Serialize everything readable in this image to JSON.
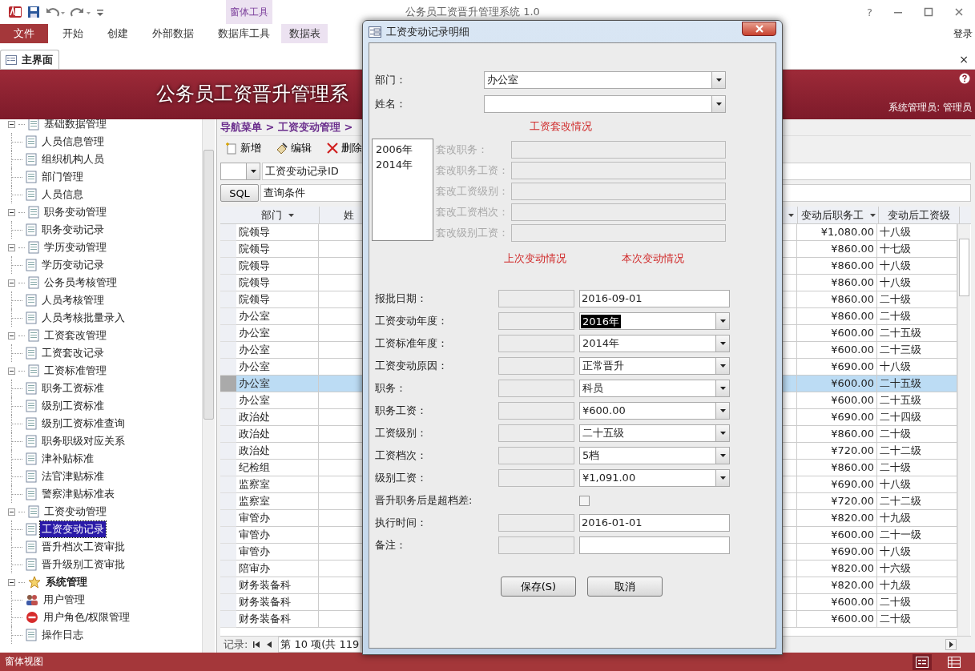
{
  "window": {
    "title": "公务员工资晋升管理系统 1.0",
    "help": "?"
  },
  "ribbon": {
    "context_label": "窗体工具",
    "file_tab": "文件",
    "tabs": [
      {
        "label": "开始",
        "selected": false
      },
      {
        "label": "创建",
        "selected": false
      },
      {
        "label": "外部数据",
        "selected": false
      },
      {
        "label": "数据库工具",
        "selected": false
      },
      {
        "label": "数据表",
        "selected": false
      }
    ],
    "login": "登录"
  },
  "document_tab": {
    "label": "主界面",
    "close": "×"
  },
  "banner": {
    "title": "公务员工资晋升管理系",
    "user": "系统管理员: 管理员"
  },
  "sidebar": {
    "items": [
      {
        "label": "基础数据管理",
        "kind": "doc",
        "expanded": true,
        "selected": false,
        "children": [
          {
            "label": "人员信息管理",
            "kind": "doc",
            "selected": false
          },
          {
            "label": "组织机构人员",
            "kind": "doc",
            "selected": false
          },
          {
            "label": "部门管理",
            "kind": "doc",
            "selected": false
          },
          {
            "label": "人员信息",
            "kind": "doc",
            "selected": false
          }
        ]
      },
      {
        "label": "职务变动管理",
        "kind": "doc",
        "expanded": true,
        "selected": false,
        "children": [
          {
            "label": "职务变动记录",
            "kind": "doc",
            "selected": false
          }
        ]
      },
      {
        "label": "学历变动管理",
        "kind": "doc",
        "expanded": true,
        "selected": false,
        "children": [
          {
            "label": "学历变动记录",
            "kind": "doc",
            "selected": false
          }
        ]
      },
      {
        "label": "公务员考核管理",
        "kind": "doc",
        "expanded": true,
        "selected": false,
        "children": [
          {
            "label": "人员考核管理",
            "kind": "doc",
            "selected": false
          },
          {
            "label": "人员考核批量录入",
            "kind": "doc",
            "selected": false
          }
        ]
      },
      {
        "label": "工资套改管理",
        "kind": "doc",
        "expanded": true,
        "selected": false,
        "children": [
          {
            "label": "工资套改记录",
            "kind": "doc",
            "selected": false
          }
        ]
      },
      {
        "label": "工资标准管理",
        "kind": "doc",
        "expanded": true,
        "selected": false,
        "children": [
          {
            "label": "职务工资标准",
            "kind": "doc",
            "selected": false
          },
          {
            "label": "级别工资标准",
            "kind": "doc",
            "selected": false
          },
          {
            "label": "级别工资标准查询",
            "kind": "doc",
            "selected": false
          },
          {
            "label": "职务职级对应关系",
            "kind": "doc",
            "selected": false
          },
          {
            "label": "津补贴标准",
            "kind": "doc",
            "selected": false
          },
          {
            "label": "法官津贴标准",
            "kind": "doc",
            "selected": false
          },
          {
            "label": "警察津贴标准表",
            "kind": "doc",
            "selected": false
          }
        ]
      },
      {
        "label": "工资变动管理",
        "kind": "doc",
        "expanded": true,
        "selected": false,
        "children": [
          {
            "label": "工资变动记录",
            "kind": "doc",
            "selected": true
          },
          {
            "label": "晋升档次工资审批",
            "kind": "doc",
            "selected": false
          },
          {
            "label": "晋升级别工资审批",
            "kind": "doc",
            "selected": false
          }
        ]
      },
      {
        "label": "系统管理",
        "kind": "star",
        "expanded": true,
        "selected": false,
        "children": [
          {
            "label": "用户管理",
            "kind": "users",
            "selected": false
          },
          {
            "label": "用户角色/权限管理",
            "kind": "forbidden",
            "selected": false
          },
          {
            "label": "操作日志",
            "kind": "doc",
            "selected": false
          }
        ]
      }
    ]
  },
  "breadcrumb": "导航菜单 > 工资变动管理 >",
  "toolbar": [
    {
      "label": "新增",
      "kind": "new"
    },
    {
      "label": "编辑",
      "kind": "edit"
    },
    {
      "label": "删除",
      "kind": "delete"
    }
  ],
  "filter": {
    "field": "工资变动记录ID",
    "sql_button": "SQL",
    "query": "查询条件"
  },
  "table": {
    "columns": [
      "部门",
      "姓",
      "变动后职务工",
      "变动后工资级"
    ],
    "rows": [
      {
        "dept": "院领导",
        "post_salary": "¥1,080.00",
        "salary_level": "十八级",
        "selected": false
      },
      {
        "dept": "院领导",
        "post_salary": "¥860.00",
        "salary_level": "十七级",
        "selected": false
      },
      {
        "dept": "院领导",
        "post_salary": "¥860.00",
        "salary_level": "十八级",
        "selected": false
      },
      {
        "dept": "院领导",
        "post_salary": "¥860.00",
        "salary_level": "十八级",
        "selected": false
      },
      {
        "dept": "院领导",
        "post_salary": "¥860.00",
        "salary_level": "二十级",
        "selected": false
      },
      {
        "dept": "办公室",
        "post_salary": "¥860.00",
        "salary_level": "二十级",
        "selected": false
      },
      {
        "dept": "办公室",
        "post_salary": "¥600.00",
        "salary_level": "二十五级",
        "selected": false
      },
      {
        "dept": "办公室",
        "post_salary": "¥600.00",
        "salary_level": "二十三级",
        "selected": false
      },
      {
        "dept": "办公室",
        "post_salary": "¥690.00",
        "salary_level": "十八级",
        "selected": false
      },
      {
        "dept": "办公室",
        "post_salary": "¥600.00",
        "salary_level": "二十五级",
        "selected": true
      },
      {
        "dept": "办公室",
        "post_salary": "¥600.00",
        "salary_level": "二十五级",
        "selected": false
      },
      {
        "dept": "政治处",
        "post_salary": "¥690.00",
        "salary_level": "二十四级",
        "selected": false
      },
      {
        "dept": "政治处",
        "post_salary": "¥860.00",
        "salary_level": "二十级",
        "selected": false
      },
      {
        "dept": "政治处",
        "post_salary": "¥720.00",
        "salary_level": "二十二级",
        "selected": false
      },
      {
        "dept": "纪检组",
        "post_salary": "¥860.00",
        "salary_level": "二十级",
        "selected": false
      },
      {
        "dept": "监察室",
        "post_salary": "¥690.00",
        "salary_level": "十八级",
        "selected": false
      },
      {
        "dept": "监察室",
        "post_salary": "¥720.00",
        "salary_level": "二十二级",
        "selected": false
      },
      {
        "dept": "审管办",
        "post_salary": "¥820.00",
        "salary_level": "十九级",
        "selected": false
      },
      {
        "dept": "审管办",
        "post_salary": "¥600.00",
        "salary_level": "二十一级",
        "selected": false
      },
      {
        "dept": "审管办",
        "post_salary": "¥690.00",
        "salary_level": "十八级",
        "selected": false
      },
      {
        "dept": "陪审办",
        "post_salary": "¥820.00",
        "salary_level": "十六级",
        "selected": false
      },
      {
        "dept": "财务装备科",
        "post_salary": "¥820.00",
        "salary_level": "十九级",
        "selected": false
      },
      {
        "dept": "财务装备科",
        "post_salary": "¥600.00",
        "salary_level": "二十级",
        "selected": false
      },
      {
        "dept": "财务装备科",
        "post_salary": "¥600.00",
        "salary_level": "二十级",
        "selected": false
      }
    ]
  },
  "record_nav": {
    "label": "记录:",
    "position": "第 10 项(共 119"
  },
  "status_bar": {
    "text": "窗体视图"
  },
  "dialog": {
    "title": "工资变动记录明细",
    "top_fields": [
      {
        "label": "部门：",
        "value": "办公室"
      },
      {
        "label": "姓名："
      }
    ],
    "reform_heading": "工资套改情况",
    "reform_years": [
      {
        "label": "2006年",
        "selected": false
      },
      {
        "label": "2014年",
        "selected": false
      }
    ],
    "reform_fields": [
      "套改职务：",
      "套改职务工资：",
      "套改工资级别：",
      "套改工资档次：",
      "套改级别工资："
    ],
    "previous_heading": "上次变动情况",
    "current_heading": "本次变动情况",
    "fields": [
      {
        "label": "报批日期：",
        "kind": "text",
        "value": "2016-09-01"
      },
      {
        "label": "工资变动年度：",
        "kind": "combo",
        "value": "2016年",
        "highlighted": true
      },
      {
        "label": "工资标准年度：",
        "kind": "combo",
        "value": "2014年",
        "highlighted": false
      },
      {
        "label": "工资变动原因：",
        "kind": "combo",
        "value": "正常晋升",
        "highlighted": false
      },
      {
        "label": "职务：",
        "kind": "combo",
        "value": "科员",
        "highlighted": false
      },
      {
        "label": "职务工资：",
        "kind": "combo",
        "value": "¥600.00",
        "highlighted": false
      },
      {
        "label": "工资级别：",
        "kind": "combo",
        "value": "二十五级",
        "highlighted": false
      },
      {
        "label": "工资档次：",
        "kind": "combo",
        "value": "5档",
        "highlighted": false
      },
      {
        "label": "级别工资：",
        "kind": "combo",
        "value": "¥1,091.00",
        "highlighted": false
      },
      {
        "label": "晋升职务后是超档差:",
        "kind": "checkbox",
        "checked": false
      },
      {
        "label": "执行时间：",
        "kind": "text",
        "value": "2016-01-01"
      },
      {
        "label": "备注：",
        "kind": "text"
      }
    ],
    "buttons": [
      "保存(S)",
      "取消"
    ]
  }
}
